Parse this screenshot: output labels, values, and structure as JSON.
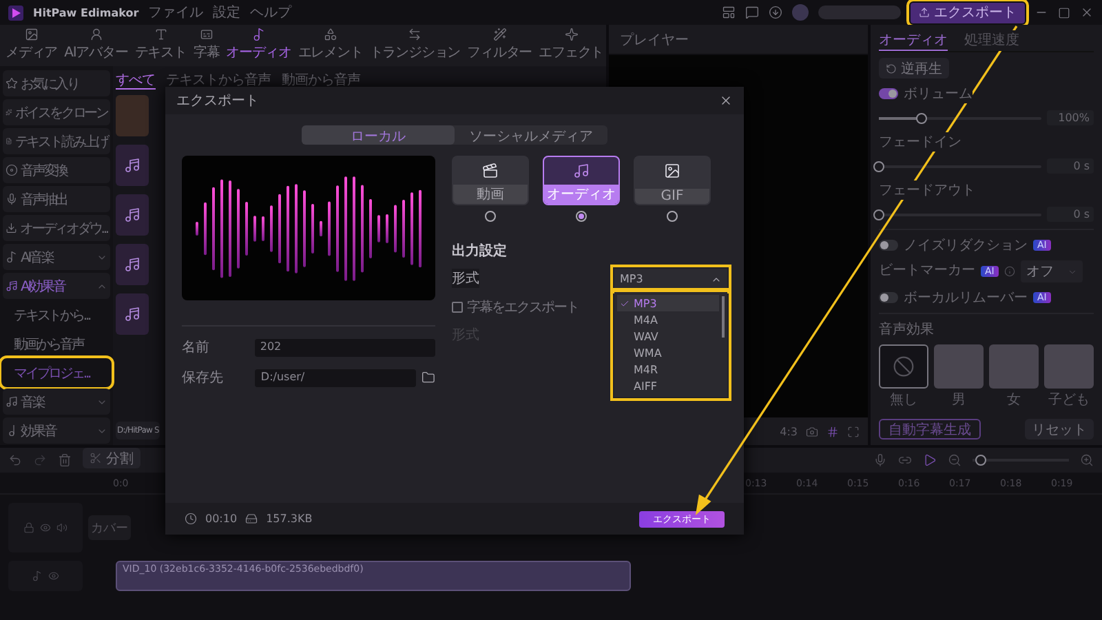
{
  "app": {
    "title": "HitPaw Edimakor",
    "menu": [
      "ファイル",
      "設定",
      "ヘルプ"
    ],
    "export_button": {
      "label": "エクスポート",
      "highlighted": true
    }
  },
  "toolbar": [
    {
      "label": "メディア",
      "selected": false
    },
    {
      "label": "AIアバター",
      "selected": false
    },
    {
      "label": "テキスト",
      "selected": false
    },
    {
      "label": "字幕",
      "selected": false
    },
    {
      "label": "オーディオ",
      "selected": true
    },
    {
      "label": "エレメント",
      "selected": false
    },
    {
      "label": "トランジション",
      "selected": false
    },
    {
      "label": "フィルター",
      "selected": false
    },
    {
      "label": "エフェクト",
      "selected": false
    }
  ],
  "sidebar": {
    "items": [
      {
        "label": "お気に入り",
        "kind": "item"
      },
      {
        "label": "ボイスをクローン",
        "kind": "item"
      },
      {
        "label": "テキスト読み上げ",
        "kind": "item"
      },
      {
        "label": "音声変換",
        "kind": "item"
      },
      {
        "label": "音声抽出",
        "kind": "item"
      },
      {
        "label": "オーディオダウ...",
        "kind": "item"
      },
      {
        "label": "AI音楽",
        "kind": "group",
        "expanded": false
      },
      {
        "label": "AI効果音",
        "kind": "group",
        "expanded": true,
        "children": [
          {
            "label": "テキストから...",
            "selected": false,
            "highlighted": false
          },
          {
            "label": "動画から音声",
            "selected": false,
            "highlighted": false
          },
          {
            "label": "マイプロジェ...",
            "selected": true,
            "highlighted": true
          }
        ]
      },
      {
        "label": "音楽",
        "kind": "group",
        "expanded": false
      },
      {
        "label": "効果音",
        "kind": "group",
        "expanded": false
      }
    ]
  },
  "media": {
    "tabs": [
      {
        "label": "すべて",
        "selected": true
      },
      {
        "label": "テキストから音声",
        "selected": false
      },
      {
        "label": "動画から音声",
        "selected": false
      }
    ],
    "path": "D:/HitPaw S"
  },
  "player": {
    "title": "プレイヤー",
    "ratio": "4:3"
  },
  "right_panel": {
    "tabs": [
      {
        "label": "オーディオ",
        "selected": true
      },
      {
        "label": "処理速度",
        "selected": false
      }
    ],
    "reverse_button": "逆再生",
    "volume": {
      "label": "ボリューム",
      "on": true,
      "level": 0.26,
      "reading": "100%"
    },
    "fade_in": {
      "label": "フェードイン",
      "level": 0,
      "reading": "0 s"
    },
    "fade_out": {
      "label": "フェードアウト",
      "level": 0,
      "reading": "0 s"
    },
    "noise_reduction": {
      "label": "ノイズリダクション",
      "on": false,
      "badge": "AI"
    },
    "beat_marker": {
      "label": "ビートマーカー",
      "badge": "AI",
      "value": "オフ"
    },
    "vocal_remover": {
      "label": "ボーカルリムーバー",
      "on": false,
      "badge": "AI"
    },
    "voice_effects": {
      "title": "音声効果",
      "options": [
        {
          "label": "無し",
          "selected": true
        },
        {
          "label": "男",
          "selected": false
        },
        {
          "label": "女",
          "selected": false
        },
        {
          "label": "子ども",
          "selected": false
        }
      ]
    },
    "auto_caption_button": "自動字幕生成",
    "reset_button": "リセット"
  },
  "timeline": {
    "split": "分割",
    "start_tick": "0:0",
    "ticks": [
      "0:13",
      "0:14",
      "0:15",
      "0:16",
      "0:17",
      "0:18",
      "0:19"
    ],
    "zoom": {
      "level": 0.04
    },
    "cover_button": "カバー",
    "clip": "VID_10 (32eb1c6-3352-4146-b0fc-2536ebedbdf0)"
  },
  "export_dialog": {
    "title": "エクスポート",
    "tabs": [
      {
        "label": "ローカル",
        "selected": true
      },
      {
        "label": "ソーシャルメディア",
        "selected": false
      }
    ],
    "formats": [
      {
        "label": "動画",
        "selected": false
      },
      {
        "label": "オーディオ",
        "selected": true
      },
      {
        "label": "GIF",
        "selected": false
      }
    ],
    "section": "出力設定",
    "format_label": "形式",
    "format_dropdown": {
      "value": "MP3",
      "expanded": true,
      "highlighted": true,
      "options": [
        {
          "label": "MP3",
          "selected": true
        },
        {
          "label": "M4A",
          "selected": false
        },
        {
          "label": "WAV",
          "selected": false
        },
        {
          "label": "WMA",
          "selected": false
        },
        {
          "label": "M4R",
          "selected": false
        },
        {
          "label": "AIFF",
          "selected": false
        }
      ]
    },
    "subtitle_checkbox": {
      "label": "字幕をエクスポート",
      "checked": false
    },
    "disabled_label": "形式",
    "name": {
      "label": "名前",
      "value": "202"
    },
    "save_to": {
      "label": "保存先",
      "value": "D:/user/"
    },
    "duration": "00:10",
    "size": "157.3KB",
    "export_button": "エクスポート"
  }
}
